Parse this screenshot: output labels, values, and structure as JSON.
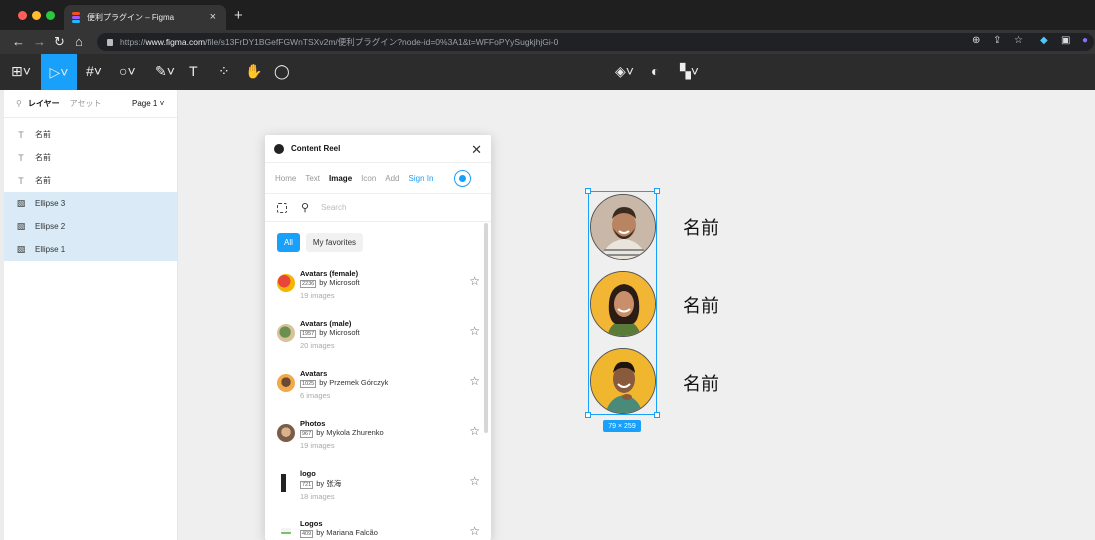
{
  "browser": {
    "tab_title": "便利プラグイン – Figma",
    "tab_close": "×",
    "new_tab": "+",
    "url_prefix": "https://",
    "url_host": "www.figma.com",
    "url_path": "/file/s13FrDY1BGefFGWnTSXv2m/便利プラグイン?node-id=0%3A1&t=WFFoPYySugkjhjGi-0"
  },
  "toolbar": {
    "main_menu_icon": "figma-menu-icon",
    "move_tool": "move-icon",
    "frame_tool": "frame-icon",
    "shape_tool": "ellipse-icon",
    "pen_tool": "pen-icon",
    "text_tool": "T",
    "resources_tool": "resources-icon",
    "hand_tool": "hand-icon",
    "comment_tool": "comment-icon"
  },
  "layers_panel": {
    "tab_layers": "レイヤー",
    "tab_assets": "アセット",
    "page": "Page 1",
    "items": [
      {
        "type": "text",
        "label": "名前"
      },
      {
        "type": "text",
        "label": "名前"
      },
      {
        "type": "text",
        "label": "名前"
      },
      {
        "type": "image",
        "label": "Ellipse 3"
      },
      {
        "type": "image",
        "label": "Ellipse 2"
      },
      {
        "type": "image",
        "label": "Ellipse 1"
      }
    ]
  },
  "plugin": {
    "title": "Content Reel",
    "tabs": [
      "Home",
      "Text",
      "Image",
      "Icon",
      "Add"
    ],
    "active_tab": "Image",
    "sign_in": "Sign In",
    "search_placeholder": "Search",
    "filters": [
      "All",
      "My favorites"
    ],
    "items": [
      {
        "name": "Avatars (female)",
        "count": "2236",
        "by": "by Microsoft",
        "images": "19 images"
      },
      {
        "name": "Avatars (male)",
        "count": "1957",
        "by": "by Microsoft",
        "images": "20 images"
      },
      {
        "name": "Avatars",
        "count": "1025",
        "by": "by Przemek Górczyk",
        "images": "6 images"
      },
      {
        "name": "Photos",
        "count": "967",
        "by": "by Mykola Zhurenko",
        "images": "19 images"
      },
      {
        "name": "logo",
        "count": "721",
        "by": "by 张海",
        "images": "18 images"
      },
      {
        "name": "Logos",
        "count": "409",
        "by": "by Mariana Falcão",
        "images": ""
      }
    ]
  },
  "canvas": {
    "selection_size": "79 × 259",
    "names": [
      "名前",
      "名前",
      "名前"
    ]
  },
  "colors": {
    "accent": "#18a0fb",
    "avatar_bg_1": "#c9b8a8",
    "avatar_bg_2": "#f2b634",
    "avatar_bg_3": "#f0b62e"
  }
}
